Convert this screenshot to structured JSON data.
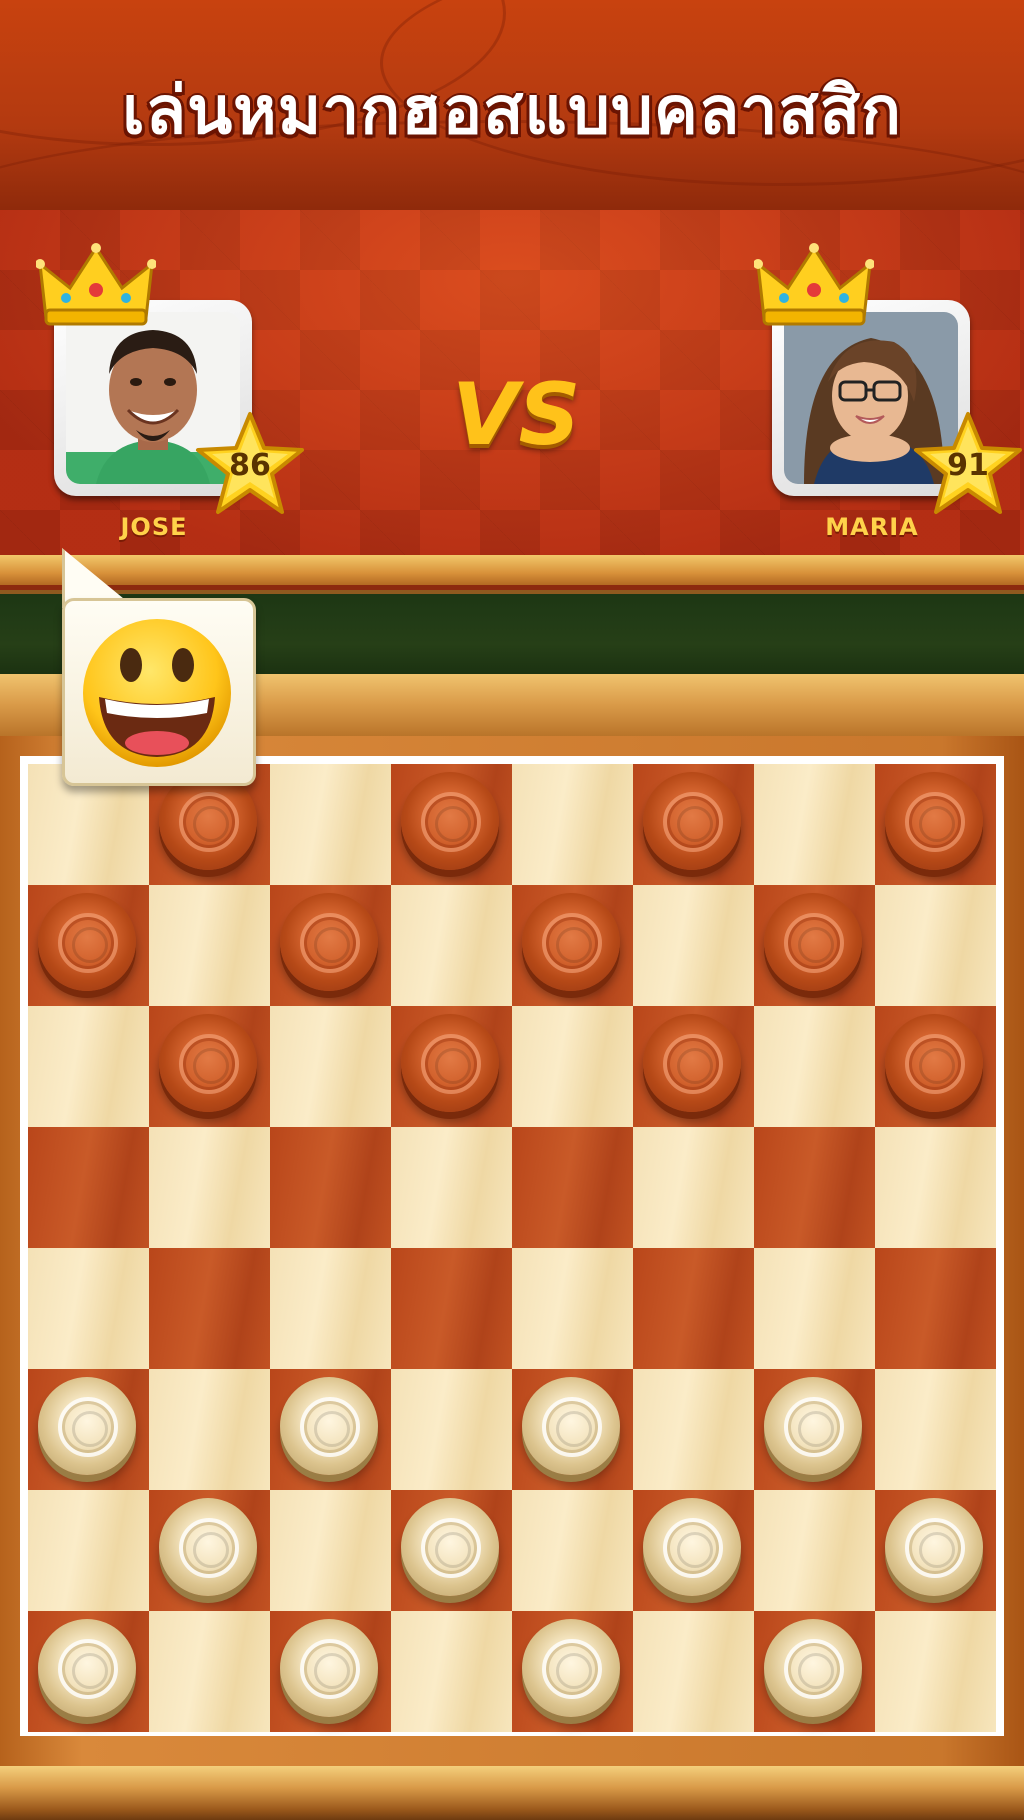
{
  "header": {
    "title": "เล่นหมากฮอสแบบคลาสสิก"
  },
  "match": {
    "vs_label": "VS"
  },
  "players": [
    {
      "name": "JOSE",
      "level": "86",
      "side": "left"
    },
    {
      "name": "MARIA",
      "level": "91",
      "side": "right"
    }
  ],
  "chat": {
    "emoji": "grinning-face-icon"
  },
  "board": {
    "size": 8,
    "rows": [
      ".r.r.r.r",
      "r.r.r.r.",
      ".r.r.r.r",
      "........",
      "........",
      "w.w.w.w.",
      ".w.w.w.w",
      "w.w.w.w."
    ]
  },
  "colors": {
    "red_piece": "#c9572a",
    "white_piece": "#ead49e",
    "dark_square": "#b9461a",
    "light_square": "#f4e1b6",
    "accent": "#ffc21a"
  }
}
